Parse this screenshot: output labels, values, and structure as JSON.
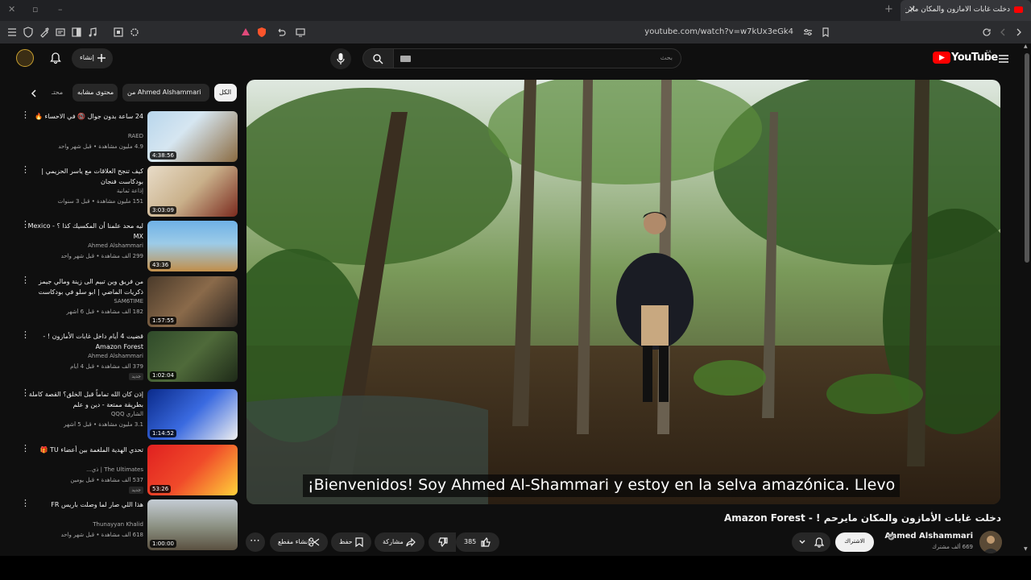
{
  "browser": {
    "tab_title": "دخلت غابات الأمازون والمكان مايرح...",
    "url": "youtube.com/watch?v=w7kUx3eGk4",
    "new_tab": "+",
    "tab_close": "✕"
  },
  "header": {
    "brand": "YouTube",
    "country": "SA",
    "search_placeholder": "بحث",
    "create_label": "إنشاء"
  },
  "chips": [
    {
      "label": "الكل",
      "active": true
    },
    {
      "label": "من Ahmed Alshammari",
      "active": false
    },
    {
      "label": "محتوى مشابه",
      "active": false
    },
    {
      "label": "محتـ",
      "active": false
    }
  ],
  "recommendations": [
    {
      "title": "24 ساعة بدون جوال 📵 في الاحساء 🔥",
      "channel": "RAED",
      "meta": "4.9 مليون مشاهدة • قبل شهر واحد",
      "duration": "4:38:56",
      "badge": ""
    },
    {
      "title": "كيف تنجح العلاقات مع ياسر الحزيمي | بودكاست فنجان",
      "channel": "إذاعة ثمانية",
      "meta": "151 مليون مشاهدة • قبل 3 سنوات",
      "duration": "3:03:09",
      "badge": ""
    },
    {
      "title": "ليه محد علمنا أن المكسيك كذا ؟ - Mexico MX",
      "channel": "Ahmed Alshammari",
      "meta": "299 ألف مشاهدة • قبل شهر واحد",
      "duration": "43:36",
      "badge": ""
    },
    {
      "title": "من فريق وين تبيم الى زينة ومالي جيمز ذكريات الماضي | ابو سلو في بودكاست تكي...",
      "channel": "SAM6TIME",
      "meta": "182 ألف مشاهدة • قبل 6 أشهر",
      "duration": "1:57:55",
      "badge": ""
    },
    {
      "title": "قضيت 4 أيام داخل غابات الأمازون ! - Amazon Forest",
      "channel": "Ahmed Alshammari",
      "meta": "379 ألف مشاهدة • قبل 4 أيام",
      "duration": "1:02:04",
      "badge": "جديد"
    },
    {
      "title": "إذن كان الله تماماً قبل الخلق؟ القصة كاملة بطريقة ممتعة - دين و علم",
      "channel": "الشاري QQQ",
      "meta": "3.1 مليون مشاهدة • قبل 5 أشهر",
      "duration": "1:14:52",
      "badge": ""
    },
    {
      "title": "تحدي الهدية الملغمة بين أعضاء TU 🎁",
      "channel": "The Ultimates | ذي...",
      "meta": "537 ألف مشاهدة • قبل يومين",
      "duration": "53:26",
      "badge": "جديد"
    },
    {
      "title": "هذا اللي صار لما وصلت باريس FR",
      "channel": "Thunayyan Khalid",
      "meta": "618 ألف مشاهدة • قبل شهر واحد",
      "duration": "1:00:00",
      "badge": ""
    }
  ],
  "player": {
    "caption": "¡Bienvenidos! Soy Ahmed Al-Shammari y estoy en la selva amazónica. Llevo"
  },
  "video": {
    "title": "دخلت غابات الأمازون والمكان مايرحم ! - Amazon Forest",
    "channel": "Ahmed Alshammari",
    "subscribers": "669 ألف مشترك",
    "subscribe_label": "الاشتراك",
    "likes": "385",
    "share_label": "مشاركة",
    "save_label": "حفظ",
    "clip_label": "إنشاء مقطع"
  },
  "colors": {
    "background": "#0f0f0f",
    "brand_red": "#ff0000",
    "chip": "#272727",
    "text": "#f1f1f1",
    "muted": "#aaaaaa"
  }
}
